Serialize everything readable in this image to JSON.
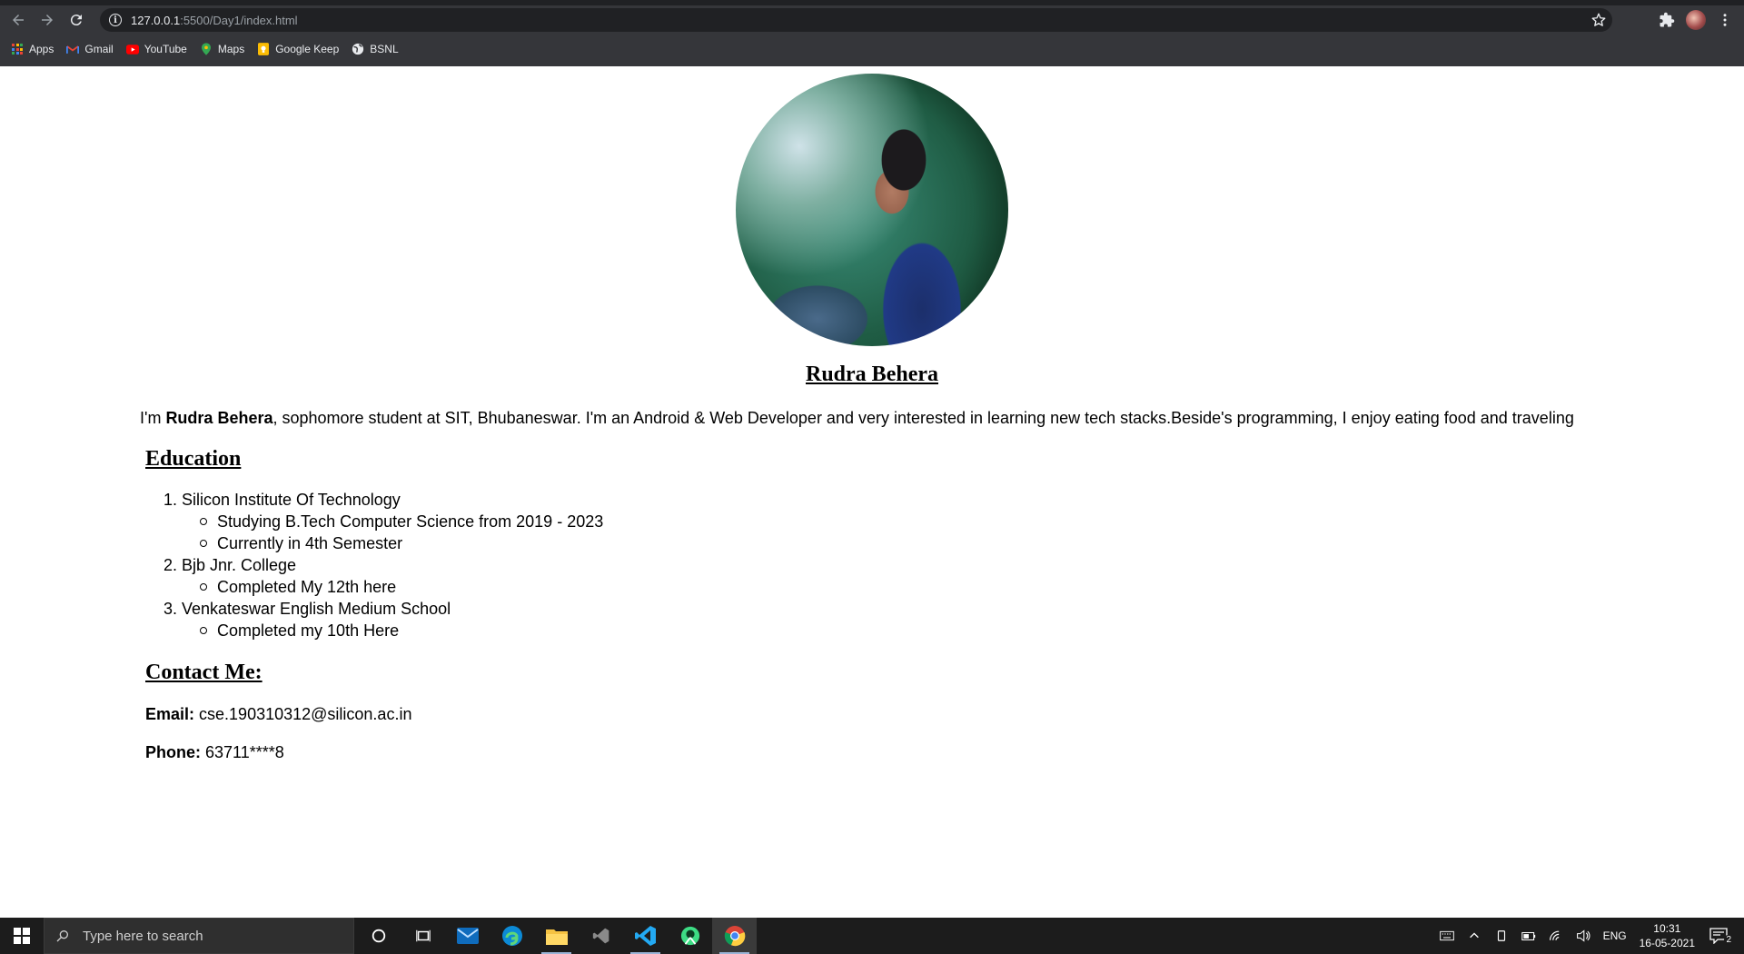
{
  "browser": {
    "url_host": "127.0.0.1",
    "url_path": ":5500/Day1/index.html",
    "bookmarks": [
      {
        "label": "Apps",
        "icon": "apps-grid-icon"
      },
      {
        "label": "Gmail",
        "icon": "gmail-icon"
      },
      {
        "label": "YouTube",
        "icon": "youtube-icon"
      },
      {
        "label": "Maps",
        "icon": "maps-pin-icon"
      },
      {
        "label": "Google Keep",
        "icon": "keep-icon"
      },
      {
        "label": "BSNL",
        "icon": "globe-icon"
      }
    ]
  },
  "page": {
    "name": "Rudra Behera",
    "intro_prefix": "I'm ",
    "intro_name": "Rudra Behera",
    "intro_rest": ", sophomore student at SIT, Bhubaneswar. I'm an Android & Web Developer and very interested in learning new tech stacks.Beside's programming, I enjoy eating food and traveling",
    "education_heading": "Education",
    "education": [
      {
        "num": "1.",
        "school": "Silicon Institute Of Technology",
        "details": [
          "Studying B.Tech Computer Science from 2019 - 2023",
          "Currently in 4th Semester"
        ]
      },
      {
        "num": "2.",
        "school": "Bjb Jnr. College",
        "details": [
          "Completed My 12th here"
        ]
      },
      {
        "num": "3.",
        "school": "Venkateswar English Medium School",
        "details": [
          "Completed my 10th Here"
        ]
      }
    ],
    "contact_heading": "Contact Me:",
    "email_label": "Email:",
    "email_value": " cse.190310312@silicon.ac.in",
    "phone_label": "Phone:",
    "phone_value": " 63711****8"
  },
  "taskbar": {
    "search_placeholder": "Type here to search",
    "lang": "ENG",
    "time": "10:31",
    "date": "16-05-2021",
    "notification_count": "2"
  },
  "colors": {
    "chrome_bg": "#35363a",
    "omnibox_bg": "#202124",
    "taskbar_bg": "#1c1c1c",
    "youtube_red": "#ff0000",
    "keep_yellow": "#fbbc04",
    "vscode_blue": "#23a9f2"
  }
}
